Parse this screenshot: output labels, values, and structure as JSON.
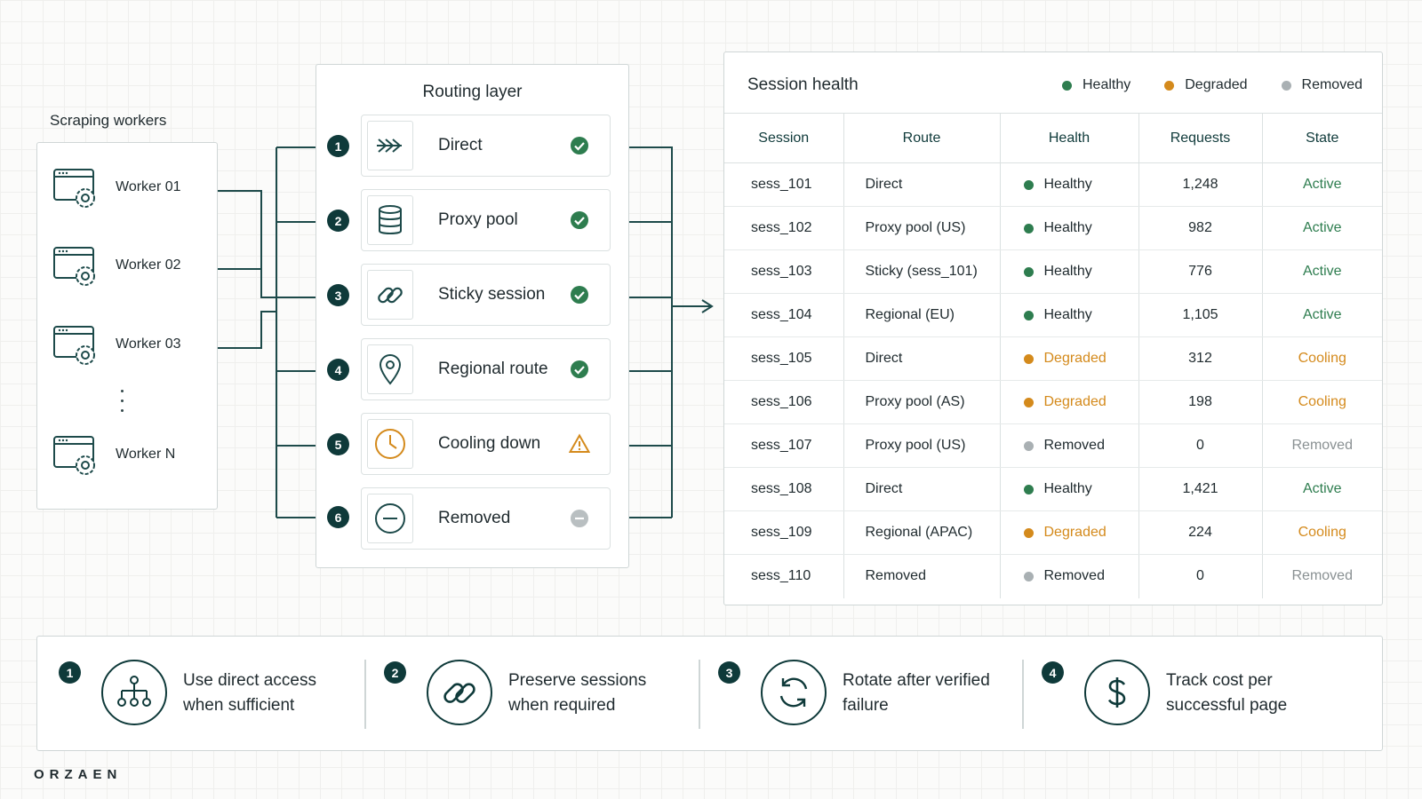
{
  "workers": {
    "title": "Scraping workers",
    "items": [
      {
        "label": "Worker 01"
      },
      {
        "label": "Worker 02"
      },
      {
        "label": "Worker 03"
      },
      {
        "label": "Worker N"
      }
    ]
  },
  "routing": {
    "title": "Routing layer",
    "items": [
      {
        "num": "1",
        "label": "Direct",
        "icon": "direct-arrows-icon",
        "status": "check-icon"
      },
      {
        "num": "2",
        "label": "Proxy pool",
        "icon": "database-icon",
        "status": "check-icon"
      },
      {
        "num": "3",
        "label": "Sticky session",
        "icon": "link-icon",
        "status": "check-icon"
      },
      {
        "num": "4",
        "label": "Regional route",
        "icon": "location-pin-icon",
        "status": "check-icon"
      },
      {
        "num": "5",
        "label": "Cooling down",
        "icon": "clock-icon",
        "status": "warning-icon"
      },
      {
        "num": "6",
        "label": "Removed",
        "icon": "minus-circle-icon",
        "status": "removed-icon"
      }
    ]
  },
  "session_health": {
    "title": "Session health",
    "legend": [
      {
        "label": "Healthy",
        "color": "#2e7d4f"
      },
      {
        "label": "Degraded",
        "color": "#d48a1c"
      },
      {
        "label": "Removed",
        "color": "#a9b0b3"
      }
    ],
    "columns": [
      "Session",
      "Route",
      "Health",
      "Requests",
      "State"
    ],
    "rows": [
      {
        "session": "sess_101",
        "route": "Direct",
        "health": "Healthy",
        "requests": "1,248",
        "state": "Active"
      },
      {
        "session": "sess_102",
        "route": "Proxy pool (US)",
        "health": "Healthy",
        "requests": "982",
        "state": "Active"
      },
      {
        "session": "sess_103",
        "route": "Sticky (sess_101)",
        "health": "Healthy",
        "requests": "776",
        "state": "Active"
      },
      {
        "session": "sess_104",
        "route": "Regional (EU)",
        "health": "Healthy",
        "requests": "1,105",
        "state": "Active"
      },
      {
        "session": "sess_105",
        "route": "Direct",
        "health": "Degraded",
        "requests": "312",
        "state": "Cooling"
      },
      {
        "session": "sess_106",
        "route": "Proxy pool (AS)",
        "health": "Degraded",
        "requests": "198",
        "state": "Cooling"
      },
      {
        "session": "sess_107",
        "route": "Proxy pool (US)",
        "health": "Removed",
        "requests": "0",
        "state": "Removed"
      },
      {
        "session": "sess_108",
        "route": "Direct",
        "health": "Healthy",
        "requests": "1,421",
        "state": "Active"
      },
      {
        "session": "sess_109",
        "route": "Regional (APAC)",
        "health": "Degraded",
        "requests": "224",
        "state": "Cooling"
      },
      {
        "session": "sess_110",
        "route": "Removed",
        "health": "Removed",
        "requests": "0",
        "state": "Removed"
      }
    ]
  },
  "colors": {
    "accent": "#0f3a3a",
    "healthy": "#2e7d4f",
    "degraded": "#d48a1c",
    "removed": "#a9b0b3",
    "state_active": "#2e7d4f",
    "state_cooling": "#d48a1c",
    "state_removed": "#8a9193"
  },
  "principles": [
    {
      "num": "1",
      "text": "Use direct access when sufficient",
      "icon": "hierarchy-icon"
    },
    {
      "num": "2",
      "text": "Preserve sessions when required",
      "icon": "link-icon"
    },
    {
      "num": "3",
      "text": "Rotate after verified failure",
      "icon": "rotate-icon"
    },
    {
      "num": "4",
      "text": "Track cost per successful page",
      "icon": "dollar-icon"
    }
  ],
  "brand": "ORZAEN"
}
